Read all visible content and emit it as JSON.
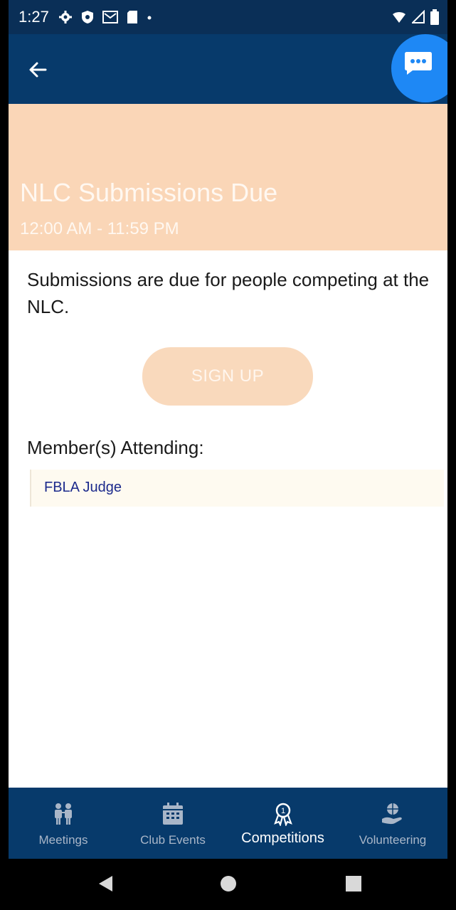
{
  "status_bar": {
    "time": "1:27",
    "icons_left": [
      "settings-icon",
      "shield-icon",
      "gmail-icon",
      "sim-card-icon",
      "dot-icon"
    ],
    "icons_right": [
      "wifi-icon",
      "signal-icon",
      "battery-icon"
    ]
  },
  "app_bar": {
    "back_icon": "arrow-left-icon",
    "chat_icon": "chat-bubble-icon",
    "background": "#073a6b",
    "fab_color": "#1e88f5"
  },
  "event": {
    "title": "NLC Submissions Due",
    "time_range": "12:00 AM  -  11:59 PM",
    "description": "Submissions are due for people competing at the NLC.",
    "header_color": "#fad6b7"
  },
  "signup": {
    "label": "SIGN UP",
    "color": "#f9d9bc"
  },
  "attending": {
    "label": "Member(s) Attending:",
    "members": [
      "FBLA Judge"
    ]
  },
  "bottom_nav": {
    "items": [
      {
        "label": "Meetings",
        "icon": "people-icon",
        "active": false
      },
      {
        "label": "Club Events",
        "icon": "calendar-icon",
        "active": false
      },
      {
        "label": "Competitions",
        "icon": "award-ribbon-icon",
        "active": true
      },
      {
        "label": "Volunteering",
        "icon": "helping-hand-globe-icon",
        "active": false
      }
    ]
  },
  "system_nav": {
    "buttons": [
      "back-triangle-icon",
      "home-circle-icon",
      "recents-square-icon"
    ]
  }
}
